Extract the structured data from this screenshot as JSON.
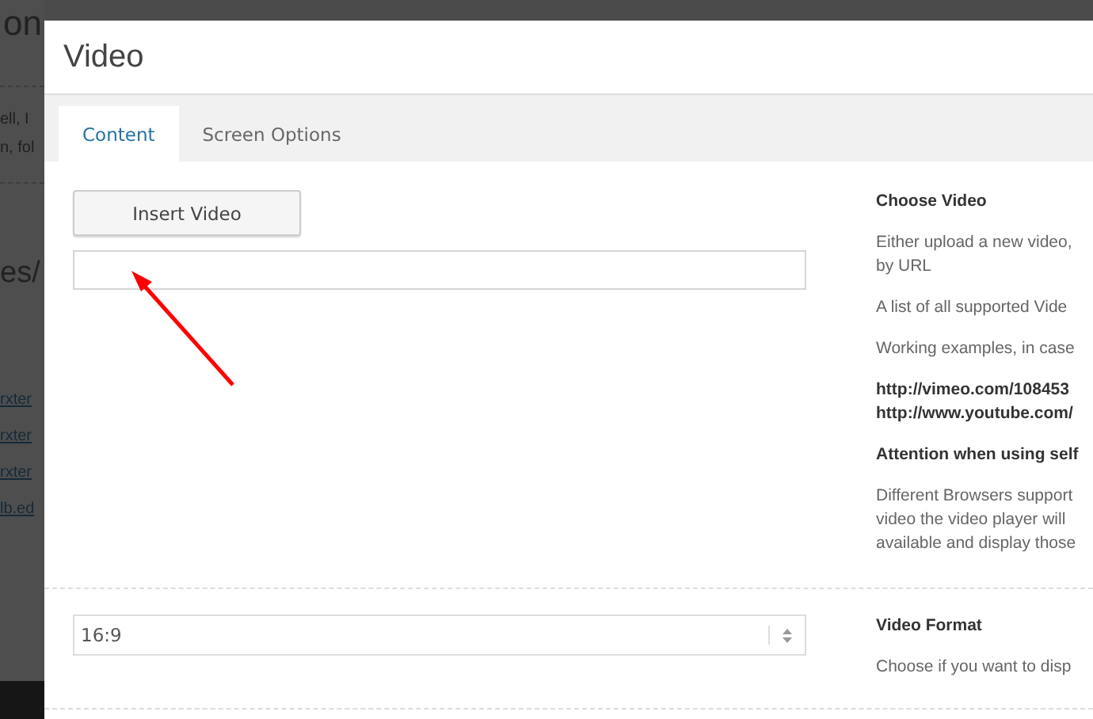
{
  "background_page": {
    "heading_1": "on",
    "paragraph_lines": [
      "ell, I",
      "n, fol"
    ],
    "heading_2": "es/",
    "links": [
      "rxter",
      "rxter",
      "rxter",
      "lb.ed"
    ]
  },
  "dialog": {
    "title": "Video",
    "tabs": [
      {
        "label": "Content",
        "selected": true
      },
      {
        "label": "Screen Options",
        "selected": false
      }
    ],
    "sections": [
      {
        "kind": "upload",
        "button": "Insert Video",
        "help": [
          {
            "bold": true,
            "lines": [
              "Choose Video"
            ]
          },
          {
            "bold": false,
            "lines": [
              "Either upload a new video,",
              "by URL"
            ]
          },
          {
            "bold": false,
            "lines": [
              "A list of all supported Vide"
            ]
          },
          {
            "bold": false,
            "lines": [
              "Working examples, in case"
            ]
          },
          {
            "bold": true,
            "lines": [
              "http://vimeo.com/108453",
              "http://www.youtube.com/"
            ]
          },
          {
            "bold": true,
            "lines": [
              "Attention when using self"
            ]
          },
          {
            "bold": false,
            "lines": [
              "Different Browsers support",
              "video the video player will",
              "available and display those"
            ]
          }
        ]
      },
      {
        "kind": "select",
        "value": "16:9",
        "help": [
          {
            "bold": true,
            "lines": [
              "Video Format"
            ]
          },
          {
            "bold": false,
            "lines": [
              "Choose if you want to disp"
            ]
          }
        ]
      }
    ]
  }
}
